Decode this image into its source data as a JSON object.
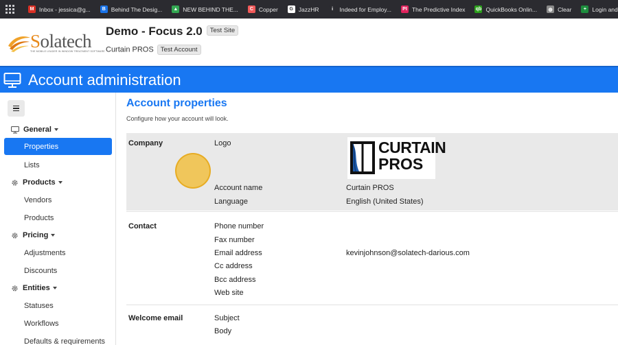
{
  "bookmarks": [
    {
      "label": "Inbox - jessica@g...",
      "icon": "gmail-icon",
      "color": "#d93025",
      "glyph": "M"
    },
    {
      "label": "Behind The Desig...",
      "icon": "calendar-icon",
      "color": "#1a73e8",
      "glyph": "B"
    },
    {
      "label": "NEW BEHIND THE...",
      "icon": "drive-icon",
      "color": "#34a853",
      "glyph": "▲"
    },
    {
      "label": "Copper",
      "icon": "copper-icon",
      "color": "#f25a5a",
      "glyph": "C"
    },
    {
      "label": "JazzHR",
      "icon": "google-icon",
      "color": "#ffffff",
      "glyph": "G"
    },
    {
      "label": "Indeed for Employ...",
      "icon": "indeed-icon",
      "color": "#2b2b30",
      "glyph": "i"
    },
    {
      "label": "The Predictive Index",
      "icon": "pi-icon",
      "color": "#e0245e",
      "glyph": "PI"
    },
    {
      "label": "QuickBooks Onlin...",
      "icon": "quickbooks-icon",
      "color": "#2ca01c",
      "glyph": "qb"
    },
    {
      "label": "Clear",
      "icon": "globe-icon",
      "color": "#8a8a8a",
      "glyph": "◍"
    },
    {
      "label": "Login and Passwor...",
      "icon": "plus-icon",
      "color": "#1e8e3e",
      "glyph": "+"
    }
  ],
  "header": {
    "brand": "Solatech",
    "brand_tagline": "THE MOBILE LEADER IN WINDOW TREATMENT SOFTWARE",
    "site_title": "Demo - Focus 2.0",
    "site_badge": "Test Site",
    "account_name": "Curtain PROS",
    "account_badge": "Test Account"
  },
  "bluebar": {
    "title": "Account administration",
    "color": "#1877f2"
  },
  "sidebar": {
    "groups": [
      {
        "label": "General",
        "icon": "monitor-icon",
        "items": [
          "Properties",
          "Lists"
        ]
      },
      {
        "label": "Products",
        "icon": "gear-icon",
        "items": [
          "Vendors",
          "Products"
        ]
      },
      {
        "label": "Pricing",
        "icon": "gear-icon",
        "items": [
          "Adjustments",
          "Discounts"
        ]
      },
      {
        "label": "Entities",
        "icon": "gear-icon",
        "items": [
          "Statuses",
          "Workflows",
          "Defaults & requirements"
        ]
      }
    ],
    "active_item": "Properties"
  },
  "main": {
    "title": "Account properties",
    "subtitle": "Configure how your account will look.",
    "sections": {
      "company": {
        "heading": "Company",
        "logo_label": "Logo",
        "logo_text_1": "CURTAIN",
        "logo_text_2": "PROS",
        "account_name_label": "Account name",
        "account_name_value": "Curtain PROS",
        "language_label": "Language",
        "language_value": "English (United States)"
      },
      "contact": {
        "heading": "Contact",
        "phone_label": "Phone number",
        "fax_label": "Fax number",
        "email_label": "Email address",
        "email_value": "kevinjohnson@solatech-darious.com",
        "cc_label": "Cc address",
        "bcc_label": "Bcc address",
        "web_label": "Web site"
      },
      "welcome": {
        "heading": "Welcome email",
        "subject_label": "Subject",
        "body_label": "Body"
      }
    }
  }
}
